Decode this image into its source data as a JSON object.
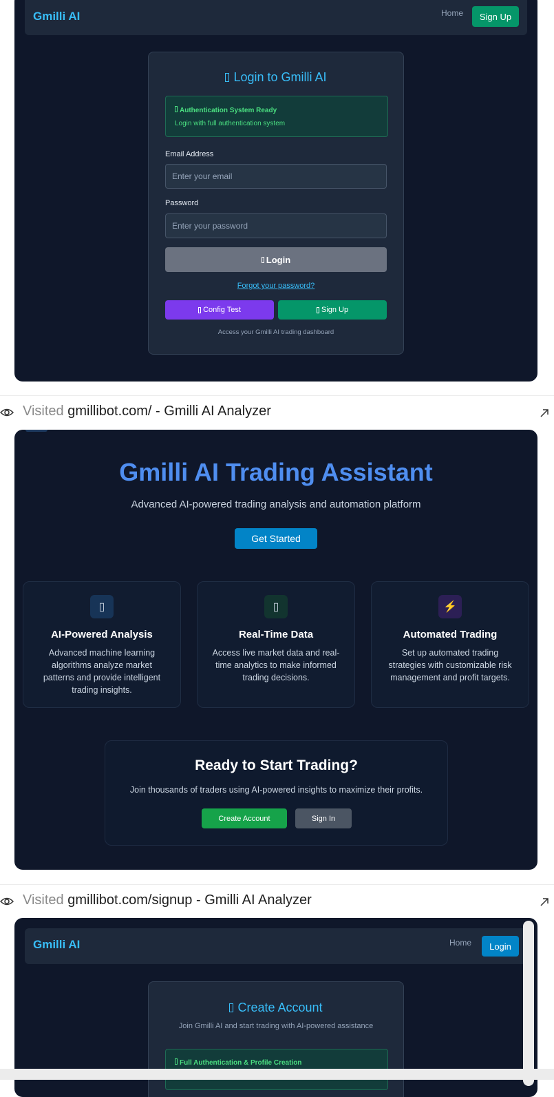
{
  "login_shot": {
    "brand": "Gmilli AI",
    "nav_home": "Home",
    "nav_signup": "Sign Up",
    "title": "Login to Gmilli AI",
    "alert_title": "Authentication System Ready",
    "alert_text": "Login with full authentication system",
    "email_label": "Email Address",
    "email_placeholder": "Enter your email",
    "password_label": "Password",
    "password_placeholder": "Enter your password",
    "login_button": "Login",
    "forgot_link": "Forgot your password?",
    "config_test_button": "Config Test",
    "signup_button": "Sign Up",
    "footer_text": "Access your Gmilli AI trading dashboard"
  },
  "visit_1": {
    "prefix": "Visited",
    "text": "gmillibot.com/ - Gmilli AI Analyzer"
  },
  "home_shot": {
    "hero_title": "Gmilli AI Trading Assistant",
    "hero_subtitle": "Advanced AI-powered trading analysis and automation platform",
    "get_started": "Get Started",
    "features": [
      {
        "icon": "▯",
        "title": "AI-Powered Analysis",
        "desc": "Advanced machine learning algorithms analyze market patterns and provide intelligent trading insights."
      },
      {
        "icon": "▯",
        "title": "Real-Time Data",
        "desc": "Access live market data and real-time analytics to make informed trading decisions."
      },
      {
        "icon": "⚡",
        "title": "Automated Trading",
        "desc": "Set up automated trading strategies with customizable risk management and profit targets."
      }
    ],
    "cta_title": "Ready to Start Trading?",
    "cta_text": "Join thousands of traders using AI-powered insights to maximize their profits.",
    "create_account": "Create Account",
    "sign_in": "Sign In"
  },
  "visit_2": {
    "prefix": "Visited",
    "text": "gmillibot.com/signup - Gmilli AI Analyzer"
  },
  "signup_shot": {
    "brand": "Gmilli AI",
    "nav_home": "Home",
    "nav_login": "Login",
    "title": "Create Account",
    "subtitle": "Join Gmilli AI and start trading with AI-powered assistance",
    "alert_title": "Full Authentication & Profile Creation"
  },
  "colors": {
    "page_bg": "#0f172a",
    "card_bg": "#1e293b",
    "accent_sky": "#38bdf8",
    "green_btn": "#059669",
    "purple_btn": "#7c3aed",
    "blue_btn": "#0284c7"
  },
  "icons": {
    "eye": "eye-icon",
    "external": "external-link-icon"
  }
}
